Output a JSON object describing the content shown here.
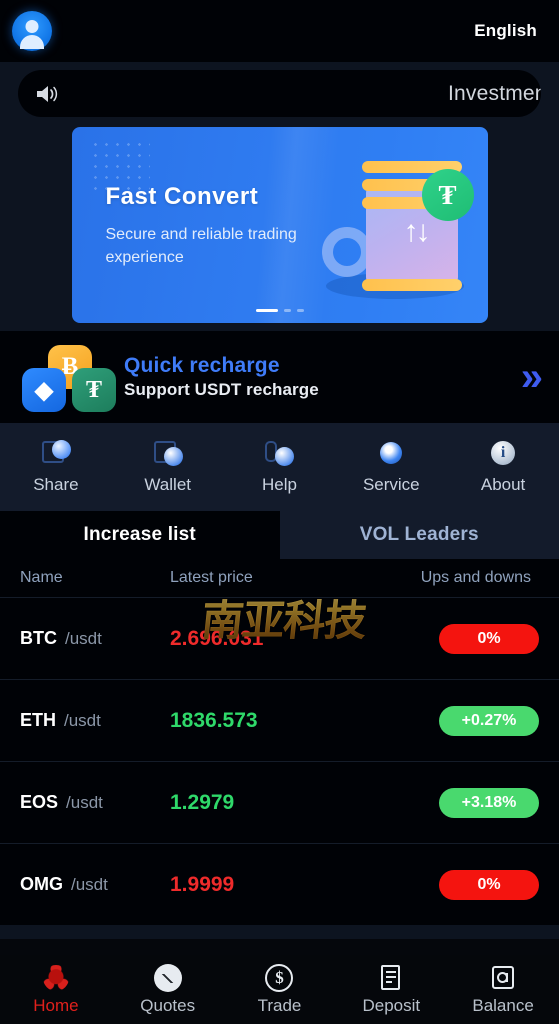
{
  "header": {
    "avatar_icon": "user-avatar-icon",
    "language": "English"
  },
  "notice": {
    "speaker_icon": "speaker-icon",
    "text": "Investment"
  },
  "banner": {
    "title": "Fast  Convert",
    "subtitle": "Secure and reliable trading experience",
    "tether_symbol": "₮",
    "swap_arrows": "↑↓",
    "slides_total": 3,
    "active_slide": 1
  },
  "recharge": {
    "title": "Quick recharge",
    "subtitle": "Support USDT recharge",
    "btc_symbol": "Ƀ",
    "eth_symbol": "◆",
    "usdt_symbol": "₮",
    "chevron": "»",
    "accent_color": "#3f7cf8"
  },
  "menu": {
    "items": [
      {
        "label": "Share",
        "icon": "share-icon"
      },
      {
        "label": "Wallet",
        "icon": "wallet-icon"
      },
      {
        "label": "Help",
        "icon": "help-icon"
      },
      {
        "label": "Service",
        "icon": "service-icon"
      },
      {
        "label": "About",
        "icon": "info-icon"
      }
    ]
  },
  "tabs": [
    {
      "label": "Increase list",
      "active": true
    },
    {
      "label": "VOL Leaders",
      "active": false
    }
  ],
  "market": {
    "columns": {
      "name": "Name",
      "price": "Latest price",
      "change": "Ups and downs"
    },
    "watermark": "南亚科技",
    "rows": [
      {
        "symbol": "BTC",
        "pair": "/usdt",
        "price": "2.696.031",
        "change": "0%",
        "direction": "down"
      },
      {
        "symbol": "ETH",
        "pair": "/usdt",
        "price": "1836.573",
        "change": "+0.27%",
        "direction": "up"
      },
      {
        "symbol": "EOS",
        "pair": "/usdt",
        "price": "1.2979",
        "change": "+3.18%",
        "direction": "up"
      },
      {
        "symbol": "OMG",
        "pair": "/usdt",
        "price": "1.9999",
        "change": "0%",
        "direction": "down"
      }
    ],
    "up_color": "#49d96e",
    "down_color": "#f4140f"
  },
  "bottom_nav": {
    "items": [
      {
        "label": "Home",
        "icon": "home-icon",
        "active": true
      },
      {
        "label": "Quotes",
        "icon": "quotes-chart-icon",
        "active": false
      },
      {
        "label": "Trade",
        "icon": "dollar-coin-icon",
        "active": false
      },
      {
        "label": "Deposit",
        "icon": "document-icon",
        "active": false
      },
      {
        "label": "Balance",
        "icon": "safe-box-icon",
        "active": false
      }
    ],
    "active_color": "#e0201c"
  }
}
